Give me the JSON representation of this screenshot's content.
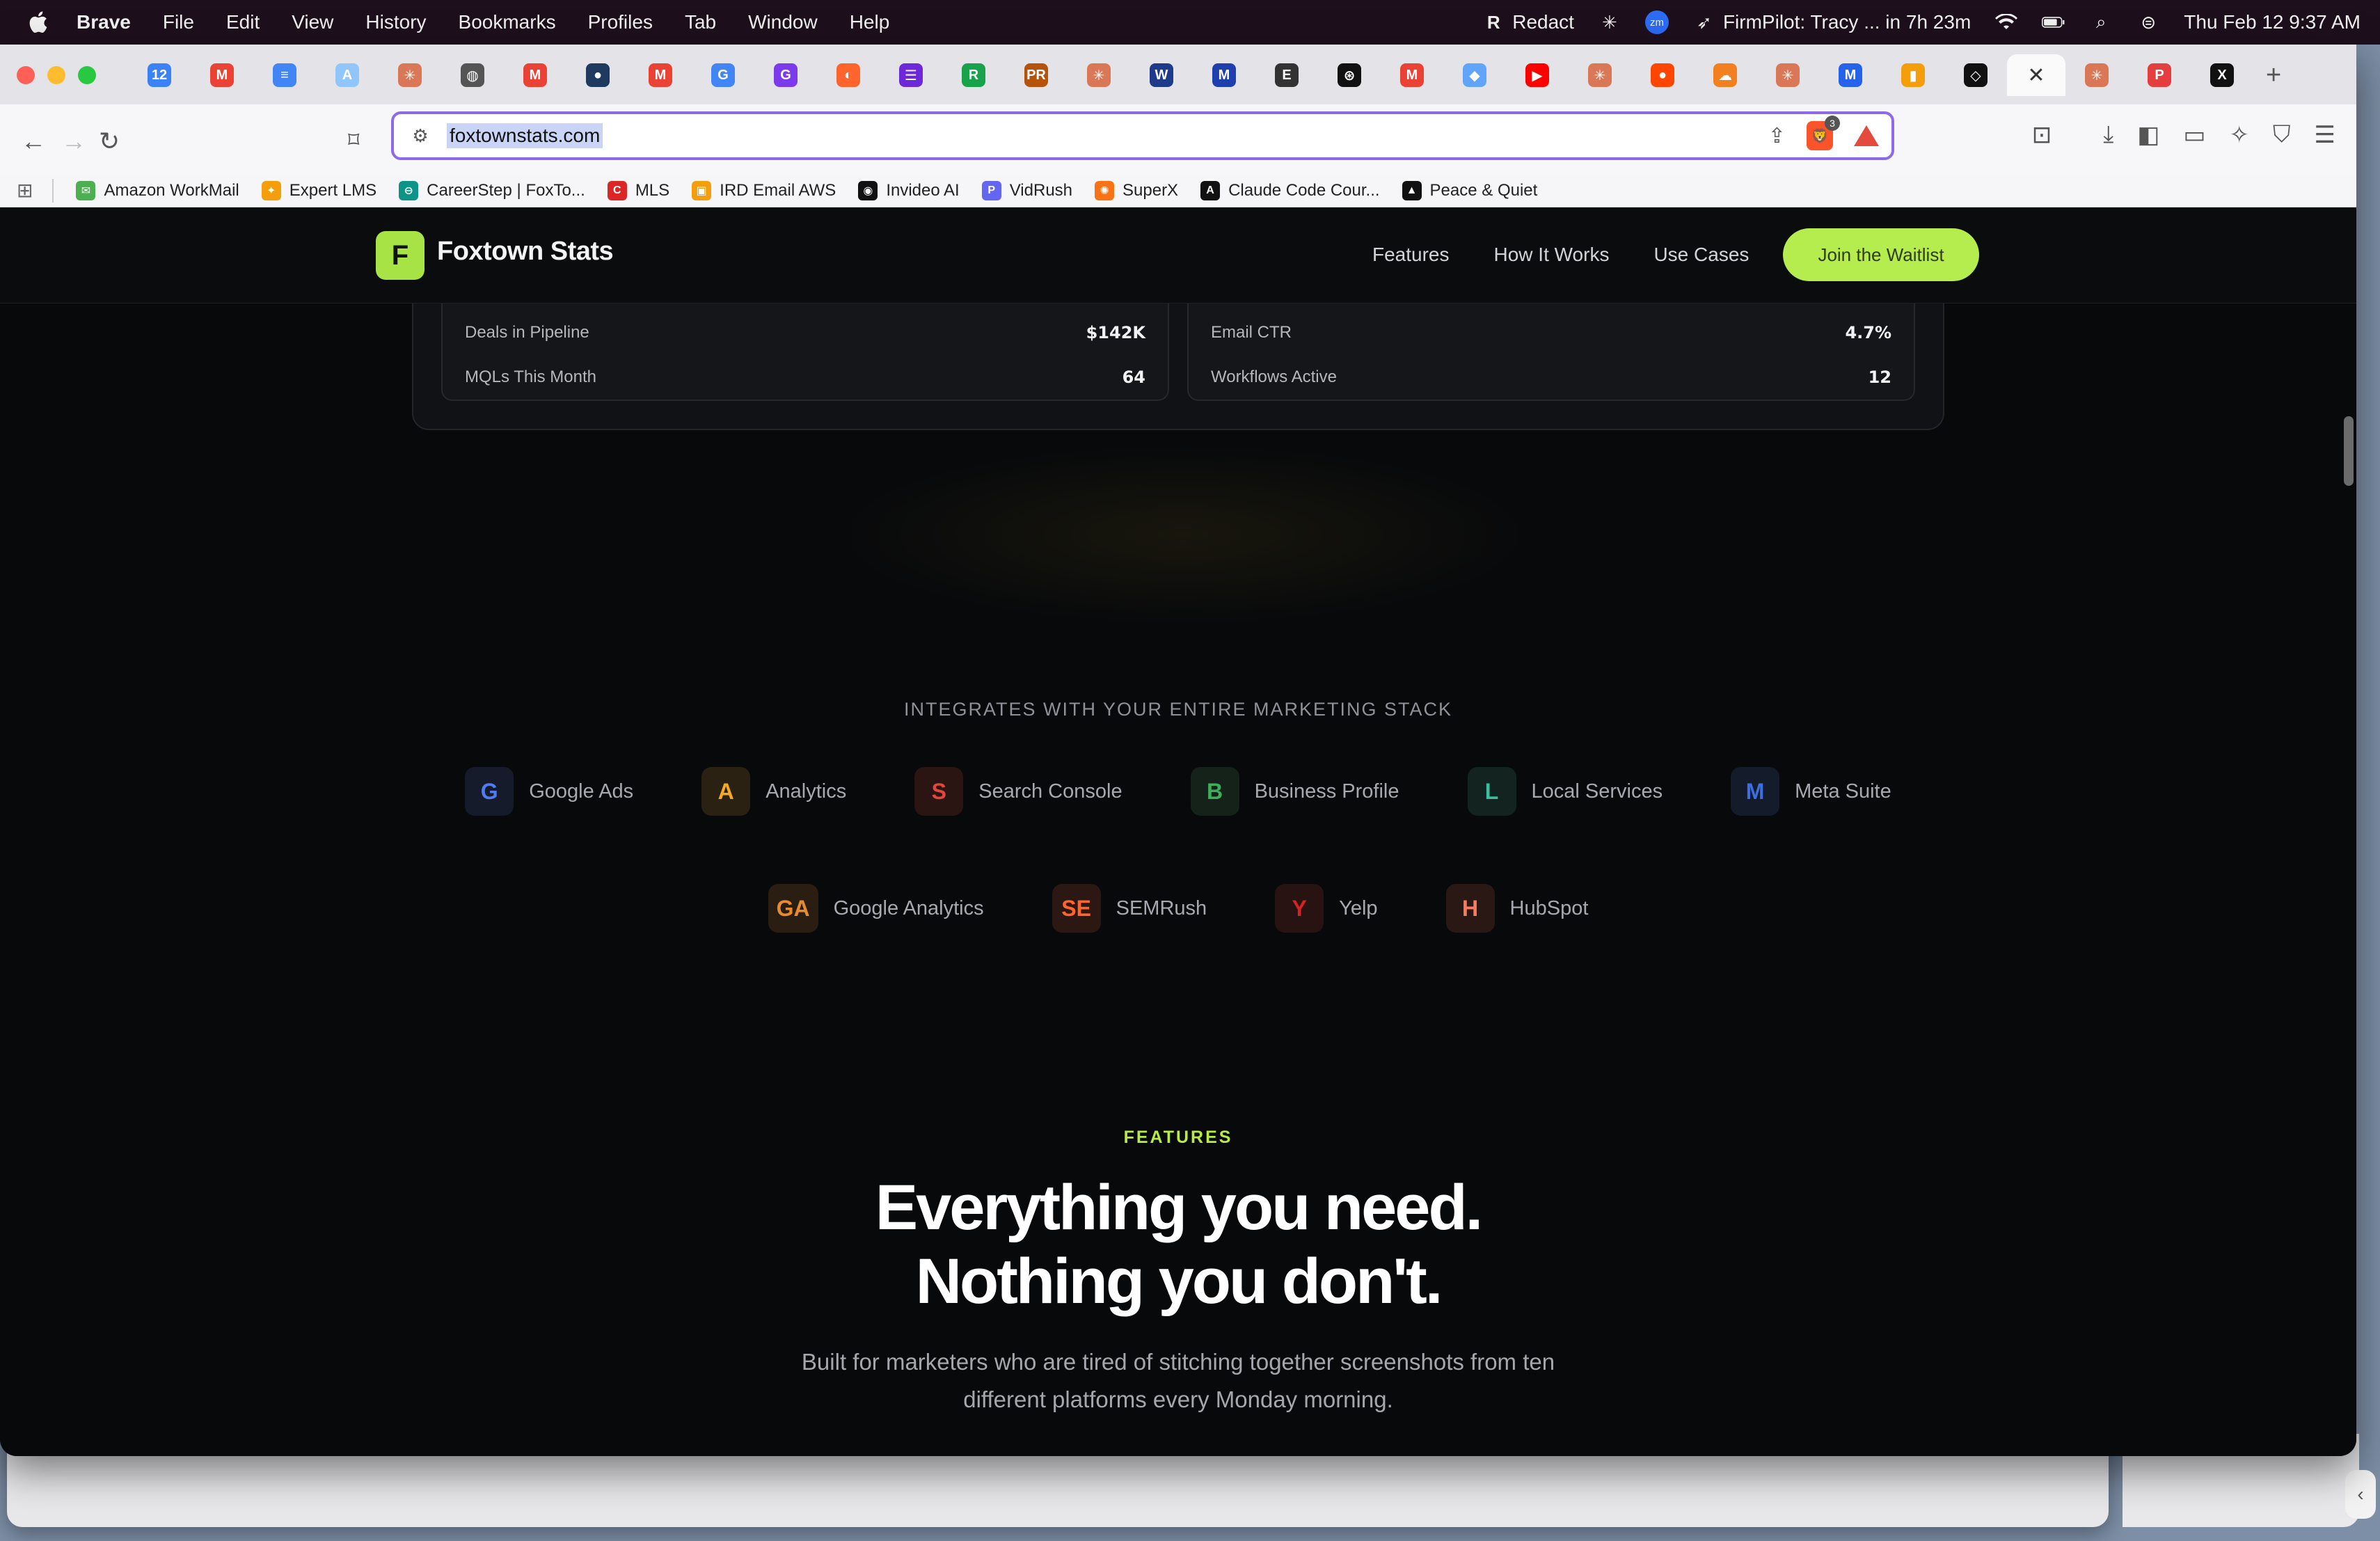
{
  "menubar": {
    "app_name": "Brave",
    "items": [
      "File",
      "Edit",
      "View",
      "History",
      "Bookmarks",
      "Profiles",
      "Tab",
      "Window",
      "Help"
    ],
    "status": {
      "redact": "Redact",
      "firmpilot": "FirmPilot: Tracy ... in 7h 23m",
      "datetime": "Thu Feb 12  9:37 AM"
    }
  },
  "browser": {
    "url": "foxtownstats.com",
    "brave_shield_count": "3",
    "tabs": [
      {
        "icon": "calendar-icon",
        "color": "#3b82f6",
        "glyph": "12"
      },
      {
        "icon": "gmail-icon",
        "color": "#ea4335",
        "glyph": "M"
      },
      {
        "icon": "docs-icon",
        "color": "#4285f4",
        "glyph": "≡"
      },
      {
        "icon": "app-icon",
        "color": "#93c5fd",
        "glyph": "A"
      },
      {
        "icon": "claude-icon",
        "color": "#d97757",
        "glyph": "✳"
      },
      {
        "icon": "globe-icon",
        "color": "#555555",
        "glyph": "◍"
      },
      {
        "icon": "gmail-icon",
        "color": "#ea4335",
        "glyph": "M"
      },
      {
        "icon": "circle-icon",
        "color": "#1e3a5f",
        "glyph": "●"
      },
      {
        "icon": "gmail-icon",
        "color": "#ea4335",
        "glyph": "M"
      },
      {
        "icon": "google-icon",
        "color": "#4285f4",
        "glyph": "G"
      },
      {
        "icon": "grammarly-icon",
        "color": "#7c3aed",
        "glyph": "G"
      },
      {
        "icon": "semrush-icon",
        "color": "#ff642d",
        "glyph": "◐"
      },
      {
        "icon": "app-icon",
        "color": "#6d28d9",
        "glyph": "☰"
      },
      {
        "icon": "rci-icon",
        "color": "#16a34a",
        "glyph": "R"
      },
      {
        "icon": "pr-icon",
        "color": "#b45309",
        "glyph": "PR"
      },
      {
        "icon": "claude-icon",
        "color": "#d97757",
        "glyph": "✳"
      },
      {
        "icon": "w-icon",
        "color": "#1e3a8a",
        "glyph": "W"
      },
      {
        "icon": "m-icon",
        "color": "#1e40af",
        "glyph": "M"
      },
      {
        "icon": "eab-icon",
        "color": "#333333",
        "glyph": "E"
      },
      {
        "icon": "openai-icon",
        "color": "#111111",
        "glyph": "⊛"
      },
      {
        "icon": "gmail-icon",
        "color": "#ea4335",
        "glyph": "M"
      },
      {
        "icon": "gemini-icon",
        "color": "#60a5fa",
        "glyph": "◆"
      },
      {
        "icon": "youtube-icon",
        "color": "#ff0000",
        "glyph": "▶"
      },
      {
        "icon": "claude-icon",
        "color": "#d97757",
        "glyph": "✳"
      },
      {
        "icon": "reddit-icon",
        "color": "#ff4500",
        "glyph": "●"
      },
      {
        "icon": "cloudflare-icon",
        "color": "#f38020",
        "glyph": "☁"
      },
      {
        "icon": "claude-icon",
        "color": "#d97757",
        "glyph": "✳"
      },
      {
        "icon": "m-icon",
        "color": "#2563eb",
        "glyph": "M"
      },
      {
        "icon": "chart-icon",
        "color": "#f59e0b",
        "glyph": "▮"
      },
      {
        "icon": "app-icon",
        "color": "#111111",
        "glyph": "◇"
      },
      {
        "icon": "active-tab-close-icon",
        "color": "#333333",
        "glyph": "✕"
      },
      {
        "icon": "claude-icon",
        "color": "#d97757",
        "glyph": "✳"
      },
      {
        "icon": "p-icon",
        "color": "#e53e3e",
        "glyph": "P"
      },
      {
        "icon": "x-icon",
        "color": "#111111",
        "glyph": "X"
      }
    ],
    "bookmarks": [
      {
        "label": "Amazon WorkMail",
        "color": "#4caf50",
        "glyph": "✉"
      },
      {
        "label": "Expert LMS",
        "color": "#f59e0b",
        "glyph": "✦"
      },
      {
        "label": "CareerStep | FoxTo...",
        "color": "#0d9488",
        "glyph": "⊖"
      },
      {
        "label": "MLS",
        "color": "#dc2626",
        "glyph": "C"
      },
      {
        "label": "IRD Email AWS",
        "color": "#f59e0b",
        "glyph": "▣"
      },
      {
        "label": "Invideo AI",
        "color": "#111111",
        "glyph": "◉"
      },
      {
        "label": "VidRush",
        "color": "#6366f1",
        "glyph": "P"
      },
      {
        "label": "SuperX",
        "color": "#f97316",
        "glyph": "✺"
      },
      {
        "label": "Claude Code Cour...",
        "color": "#111111",
        "glyph": "A"
      },
      {
        "label": "Peace & Quiet",
        "color": "#111111",
        "glyph": "▲"
      }
    ]
  },
  "site": {
    "logo_letter": "F",
    "brand": "Foxtown Stats",
    "nav": [
      "Features",
      "How It Works",
      "Use Cases"
    ],
    "cta": "Join the Waitlist",
    "dashboard": {
      "left": [
        {
          "label": "Deals in Pipeline",
          "value": "$142K"
        },
        {
          "label": "MQLs This Month",
          "value": "64"
        }
      ],
      "right": [
        {
          "label": "Email CTR",
          "value": "4.7%"
        },
        {
          "label": "Workflows Active",
          "value": "12"
        }
      ]
    },
    "integrations_label": "INTEGRATES WITH YOUR ENTIRE MARKETING STACK",
    "integrations_row1": [
      {
        "badge": "G",
        "name": "Google Ads",
        "color": "#4f7df0",
        "bg": "#151b2b"
      },
      {
        "badge": "A",
        "name": "Analytics",
        "color": "#f2a928",
        "bg": "#2a2112"
      },
      {
        "badge": "S",
        "name": "Search Console",
        "color": "#e0483b",
        "bg": "#2b1513"
      },
      {
        "badge": "B",
        "name": "Business Profile",
        "color": "#3fae5a",
        "bg": "#142219"
      },
      {
        "badge": "L",
        "name": "Local Services",
        "color": "#3dbf9f",
        "bg": "#13231f"
      },
      {
        "badge": "M",
        "name": "Meta Suite",
        "color": "#3b6fe0",
        "bg": "#141b2b"
      }
    ],
    "integrations_row2": [
      {
        "badge": "GA",
        "name": "Google Analytics",
        "color": "#e88a2e",
        "bg": "#2a1d12"
      },
      {
        "badge": "SE",
        "name": "SEMRush",
        "color": "#ff642d",
        "bg": "#2b1812"
      },
      {
        "badge": "Y",
        "name": "Yelp",
        "color": "#d32323",
        "bg": "#271312"
      },
      {
        "badge": "H",
        "name": "HubSpot",
        "color": "#ff7a59",
        "bg": "#2a1814"
      }
    ],
    "features_label": "FEATURES",
    "headline_line1": "Everything you need.",
    "headline_line2": "Nothing you don't.",
    "subcopy": "Built for marketers who are tired of stitching together screenshots from ten different platforms every Monday morning."
  }
}
